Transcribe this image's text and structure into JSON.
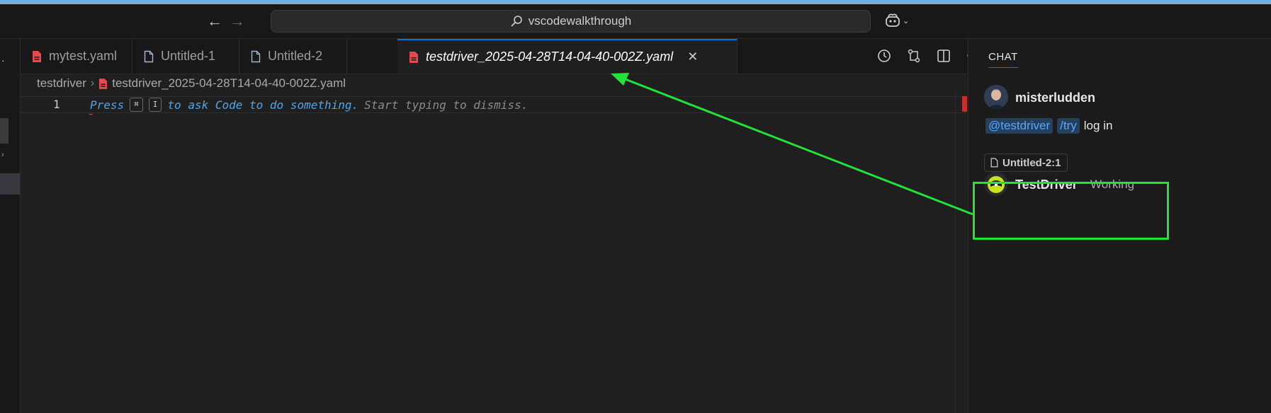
{
  "titlebar": {
    "back_icon": "arrow-left-icon",
    "forward_icon": "arrow-right-icon",
    "search_text": "vscodewalkthrough",
    "copilot_icon": "copilot-icon"
  },
  "tabs": [
    {
      "label": "mytest.yaml",
      "icon": "yaml-file-icon",
      "active": false
    },
    {
      "label": "Untitled-1",
      "icon": "file-icon",
      "active": false
    },
    {
      "label": "Untitled-2",
      "icon": "file-icon",
      "active": false
    },
    {
      "label": "testdriver_2025-04-28T14-04-40-002Z.yaml",
      "icon": "yaml-file-icon",
      "active": true
    }
  ],
  "breadcrumb": {
    "folder": "testdriver",
    "file": "testdriver_2025-04-28T14-04-40-002Z.yaml"
  },
  "editor": {
    "line_number": "1",
    "hint_press": "Press",
    "key_cmd": "⌘",
    "key_i": "I",
    "hint_ask": "to ask Code to do something.",
    "hint_dismiss": "Start typing to dismiss."
  },
  "chat": {
    "title": "CHAT",
    "user": {
      "name": "misterludden",
      "mention": "@testdriver",
      "command": "/try",
      "text": "log in"
    },
    "file_ref": "Untitled-2:1",
    "agent": {
      "name": "TestDriver",
      "status": "Working"
    }
  },
  "colors": {
    "accent": "#0078d4",
    "annotation": "#22e23a",
    "yaml_icon": "#e5484d",
    "chip_text": "#58a6ff"
  }
}
